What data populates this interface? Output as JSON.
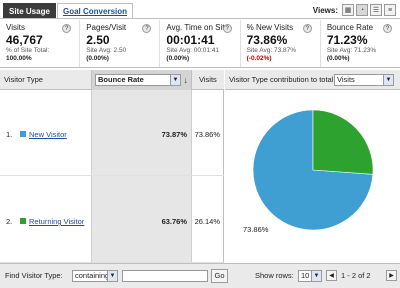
{
  "tabs": {
    "active": "Site Usage",
    "inactive": "Goal Conversion"
  },
  "views": {
    "label": "Views:"
  },
  "metrics": [
    {
      "title": "Visits",
      "value": "46,767",
      "sub1": "% of Site Total:",
      "sub2": "100.00%"
    },
    {
      "title": "Pages/Visit",
      "value": "2.50",
      "sub1": "Site Avg: 2.50",
      "sub2": "(0.00%)"
    },
    {
      "title": "Avg. Time on Site",
      "value": "00:01:41",
      "sub1": "Site Avg: 00:01:41",
      "sub2": "(0.00%)"
    },
    {
      "title": "% New Visits",
      "value": "73.86%",
      "sub1": "Site Avg: 73.87%",
      "sub2": "(-0.02%)"
    },
    {
      "title": "Bounce Rate",
      "value": "71.23%",
      "sub1": "Site Avg: 71.23%",
      "sub2": "(0.00%)"
    }
  ],
  "help_glyph": "?",
  "table": {
    "col_type": "Visitor Type",
    "col_sort": "Bounce Rate",
    "col_visits": "Visits",
    "rows": [
      {
        "num": "1.",
        "label": "New Visitor",
        "bounce": "73.87%",
        "visits": "73.86%",
        "color": "#3f9fd3"
      },
      {
        "num": "2.",
        "label": "Returning Visitor",
        "bounce": "63.76%",
        "visits": "26.14%",
        "color": "#2ea22e"
      }
    ]
  },
  "pie": {
    "header_label": "Visitor Type contribution to total:",
    "metric_select": "Visits",
    "slice_label": "73.86%"
  },
  "chart_data": {
    "type": "pie",
    "categories": [
      "New Visitor",
      "Returning Visitor"
    ],
    "values": [
      73.86,
      26.14
    ],
    "colors": [
      "#3f9fd3",
      "#2ea22e"
    ]
  },
  "footer": {
    "find_label": "Find Visitor Type:",
    "filter_mode": "containing",
    "go_label": "Go",
    "show_rows_label": "Show rows:",
    "rows_value": "10",
    "range_text": "1 - 2 of 2"
  }
}
